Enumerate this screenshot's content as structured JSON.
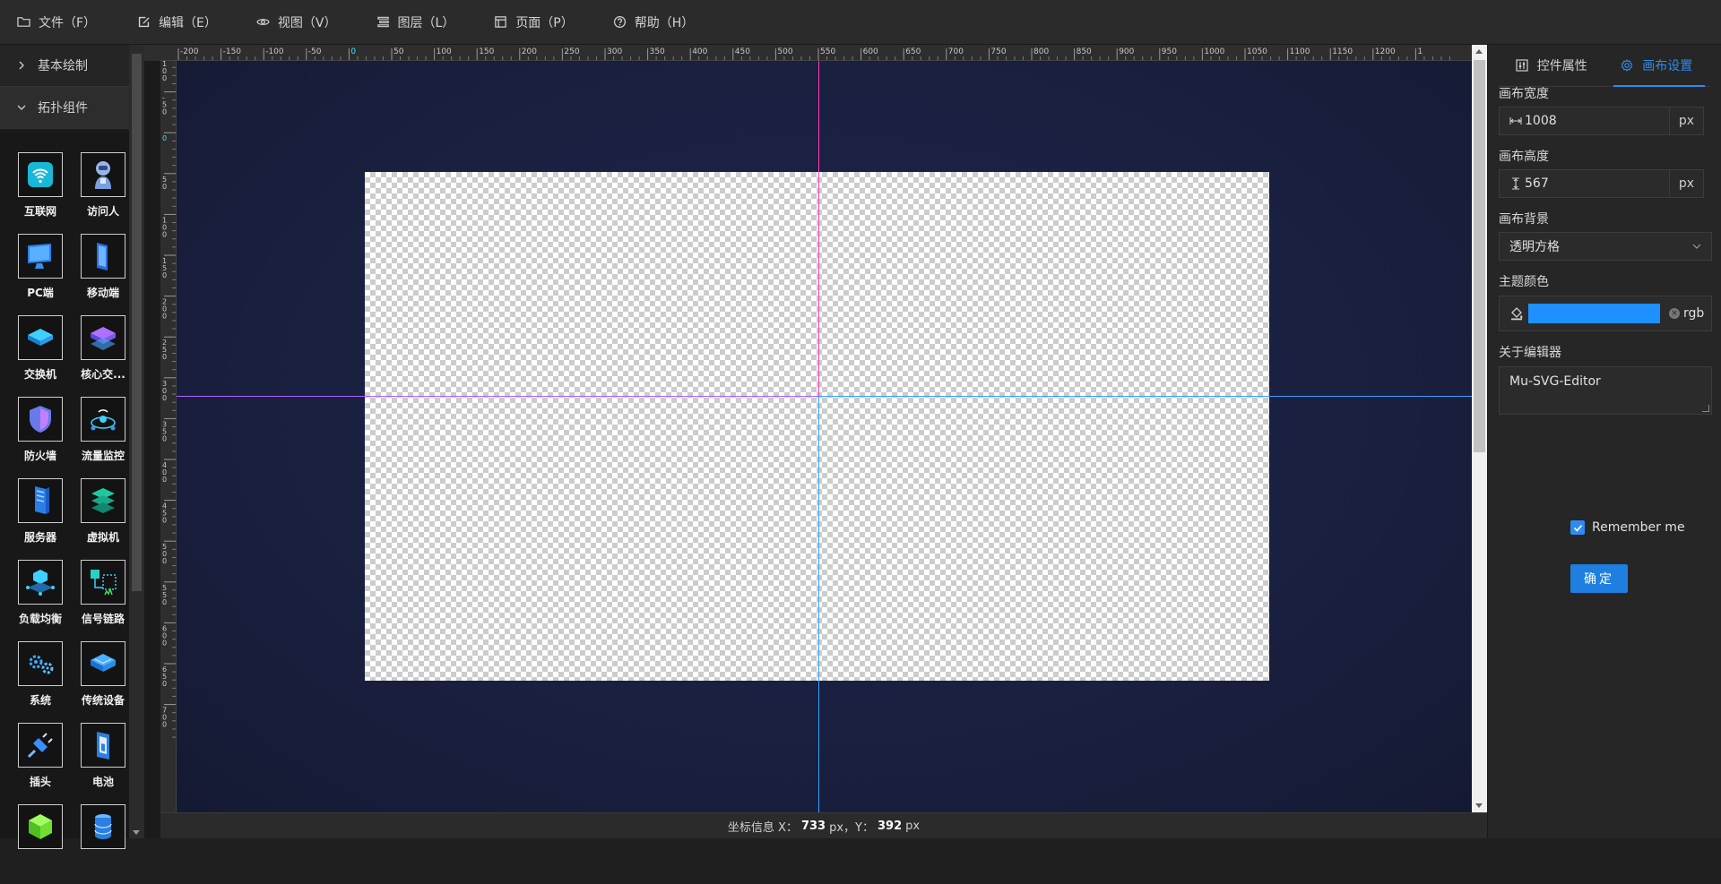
{
  "menu": [
    {
      "label": "文件（F）",
      "icon": "folder-icon"
    },
    {
      "label": "编辑（E）",
      "icon": "edit-icon"
    },
    {
      "label": "视图（V）",
      "icon": "eye-icon"
    },
    {
      "label": "图层（L）",
      "icon": "layers-icon"
    },
    {
      "label": "页面（P）",
      "icon": "page-icon"
    },
    {
      "label": "帮助（H）",
      "icon": "help-icon"
    }
  ],
  "sidebar": {
    "sections": [
      {
        "label": "基本绘制",
        "open": false
      },
      {
        "label": "拓扑组件",
        "open": true
      }
    ],
    "components": [
      {
        "label": "互联网",
        "icon": "wifi-icon"
      },
      {
        "label": "访问人",
        "icon": "robot-icon"
      },
      {
        "label": "PC端",
        "icon": "monitor-icon"
      },
      {
        "label": "移动端",
        "icon": "mobile-icon"
      },
      {
        "label": "交换机",
        "icon": "switch-icon"
      },
      {
        "label": "核心交...",
        "icon": "core-switch-icon"
      },
      {
        "label": "防火墙",
        "icon": "shield-icon"
      },
      {
        "label": "流量监控",
        "icon": "traffic-monitor-icon"
      },
      {
        "label": "服务器",
        "icon": "server-icon"
      },
      {
        "label": "虚拟机",
        "icon": "virtual-machine-icon"
      },
      {
        "label": "负载均衡",
        "icon": "load-balancer-icon"
      },
      {
        "label": "信号链路",
        "icon": "signal-link-icon"
      },
      {
        "label": "系统",
        "icon": "gears-icon"
      },
      {
        "label": "传统设备",
        "icon": "legacy-device-icon"
      },
      {
        "label": "插头",
        "icon": "plug-icon"
      },
      {
        "label": "电池",
        "icon": "battery-icon"
      },
      {
        "label": "",
        "icon": "cube-icon"
      },
      {
        "label": "",
        "icon": "database-icon"
      }
    ]
  },
  "ruler_top_labels": [
    "-200",
    "-150",
    "-100",
    "-50",
    "0",
    "50",
    "100",
    "150",
    "200",
    "250",
    "300",
    "350",
    "400",
    "450",
    "500",
    "550",
    "600",
    "650",
    "700",
    "750",
    "800",
    "850",
    "900",
    "950",
    "1000",
    "1050",
    "1100",
    "1150",
    "1200",
    "1"
  ],
  "ruler_left_labels": [
    "-100",
    "-50",
    "0",
    "50",
    "100",
    "150",
    "200",
    "250",
    "300",
    "350",
    "400",
    "450",
    "500",
    "550",
    "600",
    "650",
    "700"
  ],
  "status": {
    "prefix": "坐标信息 X：",
    "x": "733",
    "mid": "px，Y：",
    "y": "392",
    "suffix": "px"
  },
  "rpanel": {
    "tabs": [
      {
        "label": "控件属性",
        "icon": "sliders-icon",
        "active": false
      },
      {
        "label": "画布设置",
        "icon": "gear-icon",
        "active": true
      }
    ],
    "width_label": "画布宽度",
    "width_value": "1008",
    "height_label": "画布高度",
    "height_value": "567",
    "unit": "px",
    "bg_label": "画布背景",
    "bg_value": "透明方格",
    "theme_label": "主题颜色",
    "theme_color": "#1e90ff",
    "theme_mode": "rgb",
    "about_label": "关于编辑器",
    "about_value": "Mu-SVG-Editor",
    "remember_label": "Remember me",
    "remember_checked": true,
    "ok_label": "确定"
  }
}
